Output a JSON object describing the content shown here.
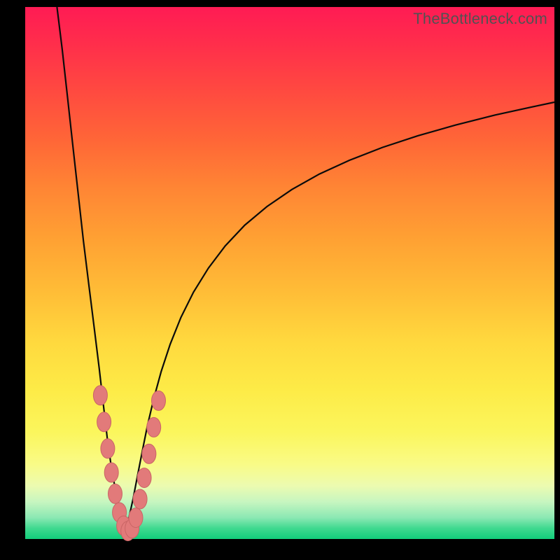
{
  "watermark_text": "TheBottleneck.com",
  "colors": {
    "frame": "#000000",
    "curve_stroke": "#0b0b0b",
    "marker_fill": "#e27a7a",
    "marker_stroke": "#c96565",
    "gradient_top": "#ff1b54",
    "gradient_bottom": "#12ce7b"
  },
  "chart_data": {
    "type": "line",
    "title": "",
    "xlabel": "",
    "ylabel": "",
    "xlim": [
      0,
      100
    ],
    "ylim": [
      0,
      100
    ],
    "grid": false,
    "legend": false,
    "series": [
      {
        "name": "left_branch",
        "x": [
          6.0,
          7.0,
          8.0,
          9.0,
          10.0,
          11.0,
          12.0,
          13.0,
          14.0,
          14.8,
          15.5,
          16.2,
          16.9,
          17.6,
          18.3,
          18.9
        ],
        "y": [
          100.0,
          92.0,
          83.0,
          74.0,
          65.0,
          56.0,
          48.0,
          40.0,
          32.0,
          25.0,
          19.0,
          14.0,
          10.0,
          6.5,
          3.5,
          1.2
        ]
      },
      {
        "name": "right_branch",
        "x": [
          18.9,
          19.6,
          20.4,
          21.2,
          22.1,
          23.1,
          24.3,
          25.7,
          27.4,
          29.4,
          31.8,
          34.6,
          37.8,
          41.5,
          45.7,
          50.4,
          55.6,
          61.3,
          67.5,
          74.2,
          81.3,
          88.8,
          96.6,
          100.0
        ],
        "y": [
          1.2,
          4.0,
          7.6,
          11.8,
          16.4,
          21.3,
          26.4,
          31.5,
          36.6,
          41.6,
          46.4,
          50.9,
          55.1,
          59.0,
          62.5,
          65.7,
          68.6,
          71.2,
          73.6,
          75.8,
          77.8,
          79.7,
          81.4,
          82.1
        ]
      }
    ],
    "markers": {
      "name": "highlighted_points",
      "points": [
        {
          "x": 14.2,
          "y": 27.0
        },
        {
          "x": 14.9,
          "y": 22.0
        },
        {
          "x": 15.6,
          "y": 17.0
        },
        {
          "x": 16.3,
          "y": 12.5
        },
        {
          "x": 17.0,
          "y": 8.5
        },
        {
          "x": 17.8,
          "y": 5.0
        },
        {
          "x": 18.6,
          "y": 2.5
        },
        {
          "x": 19.4,
          "y": 1.5
        },
        {
          "x": 20.2,
          "y": 2.0
        },
        {
          "x": 20.9,
          "y": 4.0
        },
        {
          "x": 21.7,
          "y": 7.5
        },
        {
          "x": 22.5,
          "y": 11.5
        },
        {
          "x": 23.4,
          "y": 16.0
        },
        {
          "x": 24.3,
          "y": 21.0
        },
        {
          "x": 25.2,
          "y": 26.0
        }
      ]
    }
  }
}
